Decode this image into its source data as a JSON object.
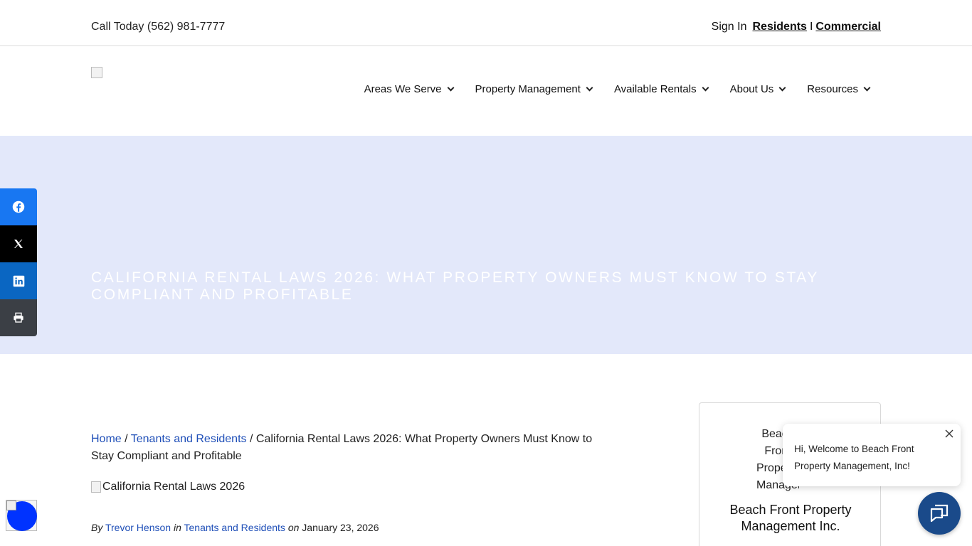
{
  "topbar": {
    "phone": "Call Today (562) 981-7777",
    "sign_in": "Sign In",
    "residents": "Residents",
    "separator": "I",
    "commercial": "Commercial"
  },
  "nav": {
    "items": [
      {
        "label": "Areas We Serve"
      },
      {
        "label": "Property Management"
      },
      {
        "label": "Available Rentals"
      },
      {
        "label": "About Us"
      },
      {
        "label": "Resources"
      }
    ]
  },
  "hero": {
    "title": "California Rental Laws 2026: What Property Owners Must Know to Stay Compliant and Profitable",
    "background": "#e3e8fa"
  },
  "share": {
    "icons": [
      "facebook-icon",
      "x-icon",
      "linkedin-icon",
      "print-icon"
    ],
    "colors": {
      "facebook": "#1877f2",
      "x": "#000000",
      "linkedin": "#0a66c2",
      "print": "#3b3f45"
    }
  },
  "breadcrumb": {
    "home": "Home",
    "sep": "/",
    "category": "Tenants and Residents",
    "current": "California Rental Laws 2026: What Property Owners Must Know to Stay Compliant and Profitable"
  },
  "featured_image": {
    "alt": "California Rental Laws 2026"
  },
  "meta": {
    "by": "By",
    "author": "Trevor Henson",
    "in": "in",
    "category": "Tenants and Residents",
    "on": "on",
    "date": "January 23, 2026"
  },
  "sidebar_card": {
    "logo_alt": "Beach Front Property Management",
    "name": "Beach Front Property Management Inc."
  },
  "chat": {
    "message": "Hi, Welcome to Beach Front Property Management, Inc!",
    "button_color": "#1a4a8a"
  }
}
